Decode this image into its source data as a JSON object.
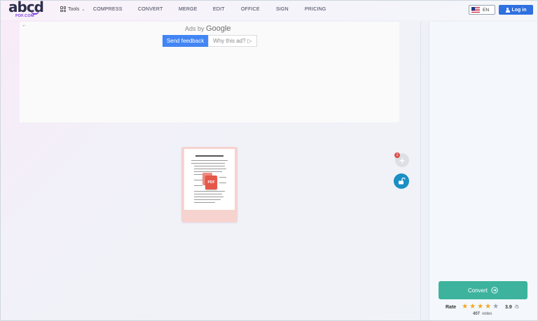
{
  "header": {
    "logo_main": "abcd",
    "logo_sub": "PDF.COM",
    "tools_label": "Tools",
    "nav": [
      "COMPRESS",
      "CONVERT",
      "MERGE",
      "EDIT",
      "OFFICE",
      "SIGN",
      "PRICING"
    ],
    "language": "EN",
    "login_label": "Log in"
  },
  "ad": {
    "ads_by": "Ads by",
    "google": "Google",
    "send_feedback": "Send feedback",
    "why_this_ad": "Why this ad?"
  },
  "document": {
    "icon_label": "PDF",
    "badge_count": "1"
  },
  "sidebar": {
    "convert_label": "Convert",
    "rate_label": "Rate",
    "stars_filled": 4,
    "stars_total": 5,
    "rating_value": "3.9",
    "rating_max": "/5",
    "votes_count": "407",
    "votes_label": "votes"
  },
  "colors": {
    "accent_blue": "#2f6fe0",
    "convert_green": "#3db39e",
    "lock_blue": "#1b8fc5",
    "star_on": "#f5a623",
    "card_pink": "#f6d3cf"
  }
}
